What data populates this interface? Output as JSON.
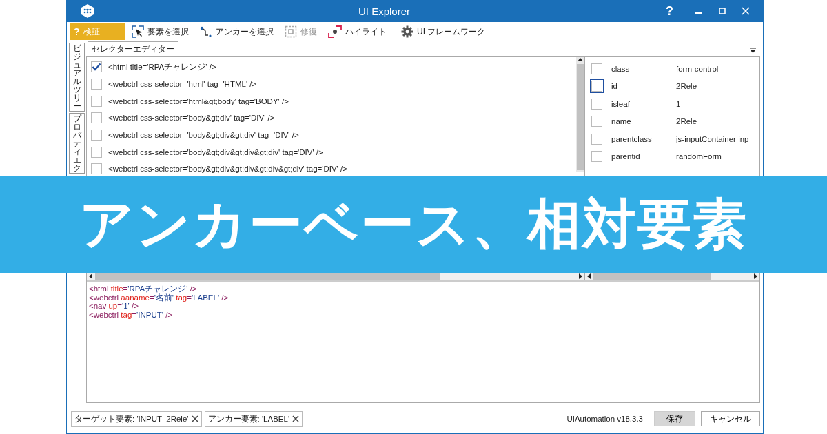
{
  "window": {
    "title": "UI Explorer",
    "help": "?"
  },
  "toolbar": [
    {
      "kind": "validate",
      "label": "検証",
      "glyph": "?",
      "disabled": false
    },
    {
      "kind": "select-element",
      "label": "要素を選択",
      "disabled": false
    },
    {
      "kind": "select-anchor",
      "label": "アンカーを選択",
      "disabled": false
    },
    {
      "kind": "repair",
      "label": "修復",
      "disabled": true
    },
    {
      "kind": "highlight",
      "label": "ハイライト",
      "disabled": false
    },
    {
      "kind": "framework",
      "label": "UI フレームワーク",
      "disabled": false
    }
  ],
  "side_tabs": [
    {
      "label": "ビジュアルツリー"
    },
    {
      "label": "プロパティエク"
    }
  ],
  "tab": {
    "label": "セレクターエディター"
  },
  "selector_rows": [
    {
      "text": "<html title='RPAチャレンジ' />",
      "checked": true
    },
    {
      "text": "<webctrl css-selector='html' tag='HTML' />",
      "checked": false
    },
    {
      "text": "<webctrl css-selector='html&gt;body' tag='BODY' />",
      "checked": false
    },
    {
      "text": "<webctrl css-selector='body&gt;div' tag='DIV' />",
      "checked": false
    },
    {
      "text": "<webctrl css-selector='body&gt;div&gt;div' tag='DIV' />",
      "checked": false
    },
    {
      "text": "<webctrl css-selector='body&gt;div&gt;div&gt;div' tag='DIV' />",
      "checked": false
    },
    {
      "text": "<webctrl css-selector='body&gt;div&gt;div&gt;div&gt;div' tag='DIV' />",
      "checked": false
    }
  ],
  "properties": [
    {
      "name": "class",
      "value": "form-control",
      "checked": false,
      "focused": false
    },
    {
      "name": "id",
      "value": "2Rele",
      "checked": false,
      "focused": true
    },
    {
      "name": "isleaf",
      "value": "1",
      "checked": false,
      "focused": false
    },
    {
      "name": "name",
      "value": "2Rele",
      "checked": false,
      "focused": false
    },
    {
      "name": "parentclass",
      "value": "js-inputContainer inp",
      "checked": false,
      "focused": false
    },
    {
      "name": "parentid",
      "value": "randomForm",
      "checked": false,
      "focused": false
    }
  ],
  "editor_lines": [
    {
      "tokens": [
        {
          "kind": "tag",
          "text": "<html "
        },
        {
          "kind": "attr",
          "text": "title"
        },
        {
          "kind": "tag",
          "text": "="
        },
        {
          "kind": "value",
          "text": "'RPAチャレンジ'"
        },
        {
          "kind": "tag",
          "text": " />"
        }
      ]
    },
    {
      "tokens": [
        {
          "kind": "tag",
          "text": "<webctrl "
        },
        {
          "kind": "attr",
          "text": "aaname"
        },
        {
          "kind": "tag",
          "text": "="
        },
        {
          "kind": "value",
          "text": "'名前'"
        },
        {
          "kind": "attr",
          "text": " tag"
        },
        {
          "kind": "tag",
          "text": "="
        },
        {
          "kind": "value",
          "text": "'LABEL'"
        },
        {
          "kind": "tag",
          "text": " />"
        }
      ]
    },
    {
      "tokens": [
        {
          "kind": "tag",
          "text": "<nav "
        },
        {
          "kind": "attr",
          "text": "up"
        },
        {
          "kind": "tag",
          "text": "="
        },
        {
          "kind": "value",
          "text": "'1'"
        },
        {
          "kind": "tag",
          "text": " />"
        }
      ]
    },
    {
      "tokens": [
        {
          "kind": "tag",
          "text": "<webctrl "
        },
        {
          "kind": "attr",
          "text": "tag"
        },
        {
          "kind": "tag",
          "text": "="
        },
        {
          "kind": "value",
          "text": "'INPUT'"
        },
        {
          "kind": "tag",
          "text": " />"
        }
      ]
    }
  ],
  "footer": {
    "chips": [
      {
        "label": "ターゲット要素: 'INPUT  2Rele'"
      },
      {
        "label": "アンカー要素: 'LABEL'"
      }
    ],
    "version": "UIAutomation v18.3.3",
    "buttons": [
      {
        "label": "保存",
        "primary": true
      },
      {
        "label": "キャンセル",
        "primary": false
      }
    ]
  },
  "banner": {
    "text": "アンカーベース、相対要素"
  }
}
